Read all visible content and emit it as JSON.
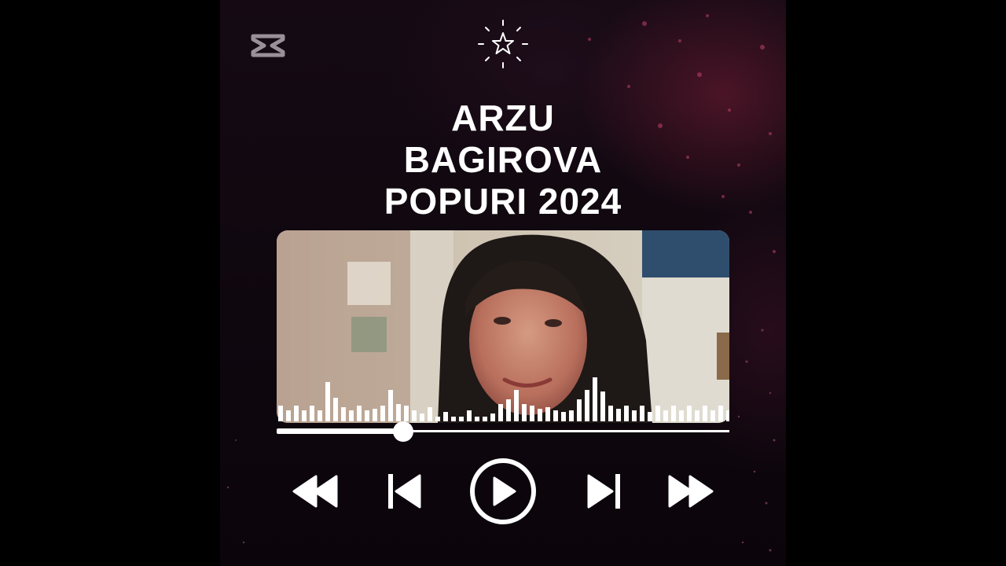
{
  "title_lines": [
    "ARZU",
    "BAGIROVA",
    "POPURI 2024"
  ],
  "player": {
    "progress_fraction": 0.28
  },
  "icons": {
    "logo": "capcut-logo-icon",
    "badge": "sparkle-star-icon",
    "rewind": "rewind-icon",
    "previous": "skip-previous-icon",
    "play": "play-circle-icon",
    "next": "skip-next-icon",
    "fast_forward": "fast-forward-icon"
  },
  "colors": {
    "foreground": "#ffffff",
    "background": "#0f070e",
    "accent_glow": "#7a1e37"
  }
}
